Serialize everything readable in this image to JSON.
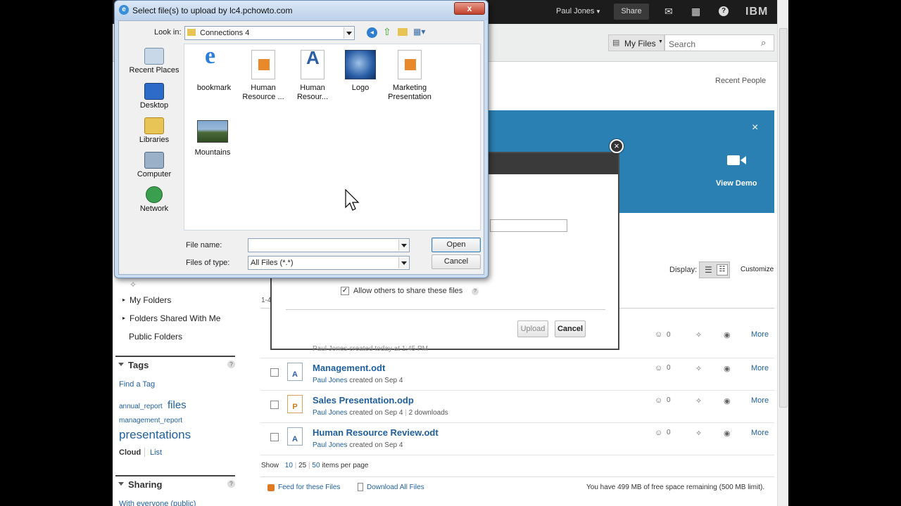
{
  "header": {
    "user": "Paul Jones",
    "share_label": "Share",
    "logo": "IBM"
  },
  "toolbar": {
    "myfiles_label": "My Files",
    "search_placeholder": "Search",
    "recent_people": "Recent People"
  },
  "banner": {
    "close": "×",
    "view_demo": "View Demo"
  },
  "display": {
    "label": "Display:",
    "customize": "Customize",
    "count_prefix": "1-4"
  },
  "sidebar": {
    "pin_dot": "·",
    "my_folders": "My Folders",
    "folders_shared": "Folders Shared With Me",
    "public_folders": "Public Folders",
    "tags_header": "Tags",
    "find_tag": "Find a Tag",
    "tags": [
      "annual_report",
      "files",
      "management_report",
      "presentations"
    ],
    "cloud": "Cloud",
    "list": "List",
    "sharing_header": "Sharing",
    "sharing_item": "With everyone (public)",
    "help": "?"
  },
  "upload_dialog": {
    "allow_share": "Allow others to share these files",
    "upload": "Upload",
    "cancel": "Cancel",
    "behind_row_meta": "Paul Jones created today at 1:45 PM",
    "help": "?"
  },
  "files": [
    {
      "name": "Management.odt",
      "author": "Paul Jones",
      "meta": "created on Sep 4",
      "downloads": "",
      "count": "0",
      "more": "More",
      "icon": "A"
    },
    {
      "name": "Sales Presentation.odp",
      "author": "Paul Jones",
      "meta": "created on Sep 4",
      "downloads": "2 downloads",
      "count": "0",
      "more": "More",
      "icon": "P"
    },
    {
      "name": "Human Resource Review.odt",
      "author": "Paul Jones",
      "meta": "created on Sep 4",
      "downloads": "",
      "count": "0",
      "more": "More",
      "icon": "A"
    }
  ],
  "first_row": {
    "count": "0",
    "more": "More"
  },
  "paging": {
    "show": "Show",
    "opt10": "10",
    "opt25": "25",
    "opt50": "50",
    "suffix": "items per page"
  },
  "footer": {
    "feed": "Feed for these Files",
    "download_all": "Download All Files",
    "space": "You have 499 MB of free space remaining (500 MB limit)."
  },
  "file_dialog": {
    "title": "Select file(s) to upload by lc4.pchowto.com",
    "close": "x",
    "look_in_label": "Look in:",
    "look_in_value": "Connections 4",
    "places": [
      "Recent Places",
      "Desktop",
      "Libraries",
      "Computer",
      "Network"
    ],
    "files": [
      {
        "line1": "bookmark",
        "line2": ""
      },
      {
        "line1": "Human",
        "line2": "Resource ..."
      },
      {
        "line1": "Human",
        "line2": "Resour..."
      },
      {
        "line1": "Logo",
        "line2": ""
      },
      {
        "line1": "Marketing",
        "line2": "Presentation"
      },
      {
        "line1": "Mountains",
        "line2": ""
      }
    ],
    "file_name_label": "File name:",
    "file_name_value": "",
    "type_label": "Files of type:",
    "type_value": "All Files (*.*)",
    "open": "Open",
    "cancel": "Cancel"
  },
  "colors": {
    "banner": "#2a80b2",
    "topbar": "#1c1c1c",
    "link": "#1f5f9e",
    "dialog_frame": "#c9dcf0"
  }
}
